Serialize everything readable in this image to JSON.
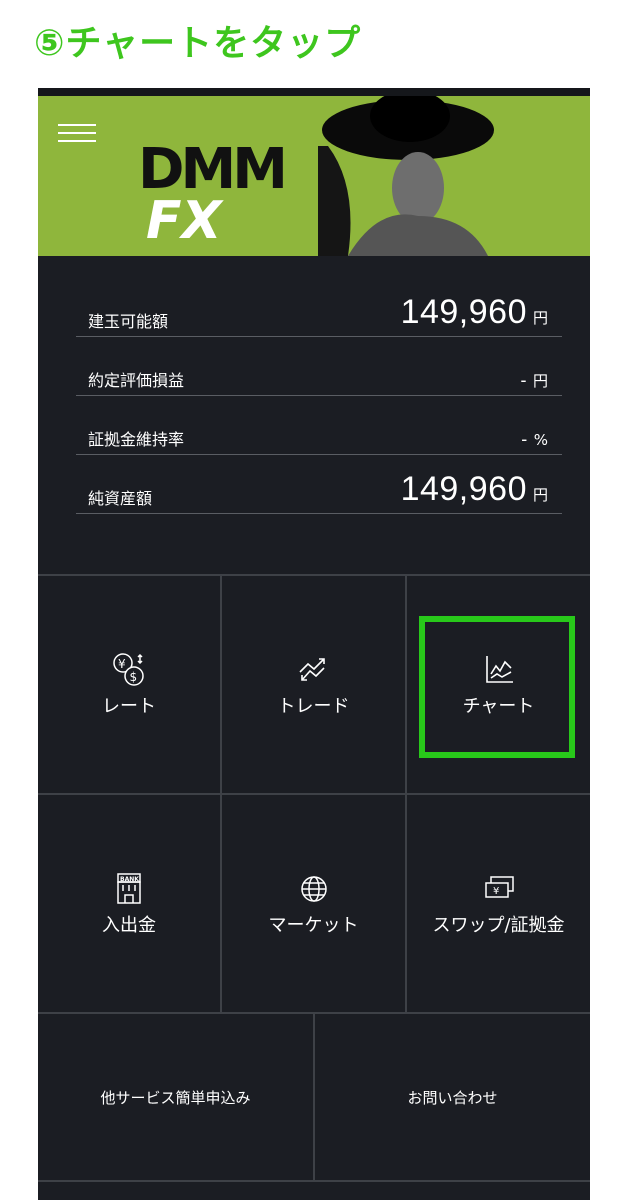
{
  "instruction": "⑤チャートをタップ",
  "colors": {
    "accent": "#28c81a",
    "banner": "#8fb63c",
    "background": "#1b1d23"
  },
  "header": {
    "menu_icon": "hamburger-icon",
    "logo": "DMM FX"
  },
  "summary": [
    {
      "label": "建玉可能額",
      "value": "149,960",
      "unit": "円"
    },
    {
      "label": "約定評価損益",
      "value": "-",
      "unit": "円"
    },
    {
      "label": "証拠金維持率",
      "value": "-",
      "unit": "%"
    },
    {
      "label": "純資産額",
      "value": "149,960",
      "unit": "円"
    }
  ],
  "menu": {
    "rate": {
      "label": "レート",
      "icon": "currency-exchange-icon"
    },
    "trade": {
      "label": "トレード",
      "icon": "trend-arrows-icon"
    },
    "chart": {
      "label": "チャート",
      "icon": "line-chart-icon"
    },
    "deposit": {
      "label": "入出金",
      "icon": "bank-icon"
    },
    "market": {
      "label": "マーケット",
      "icon": "globe-icon"
    },
    "swap": {
      "label": "スワップ/証拠金",
      "icon": "yen-bills-icon"
    },
    "services": {
      "label": "他サービス簡単申込み"
    },
    "contact": {
      "label": "お問い合わせ"
    }
  }
}
